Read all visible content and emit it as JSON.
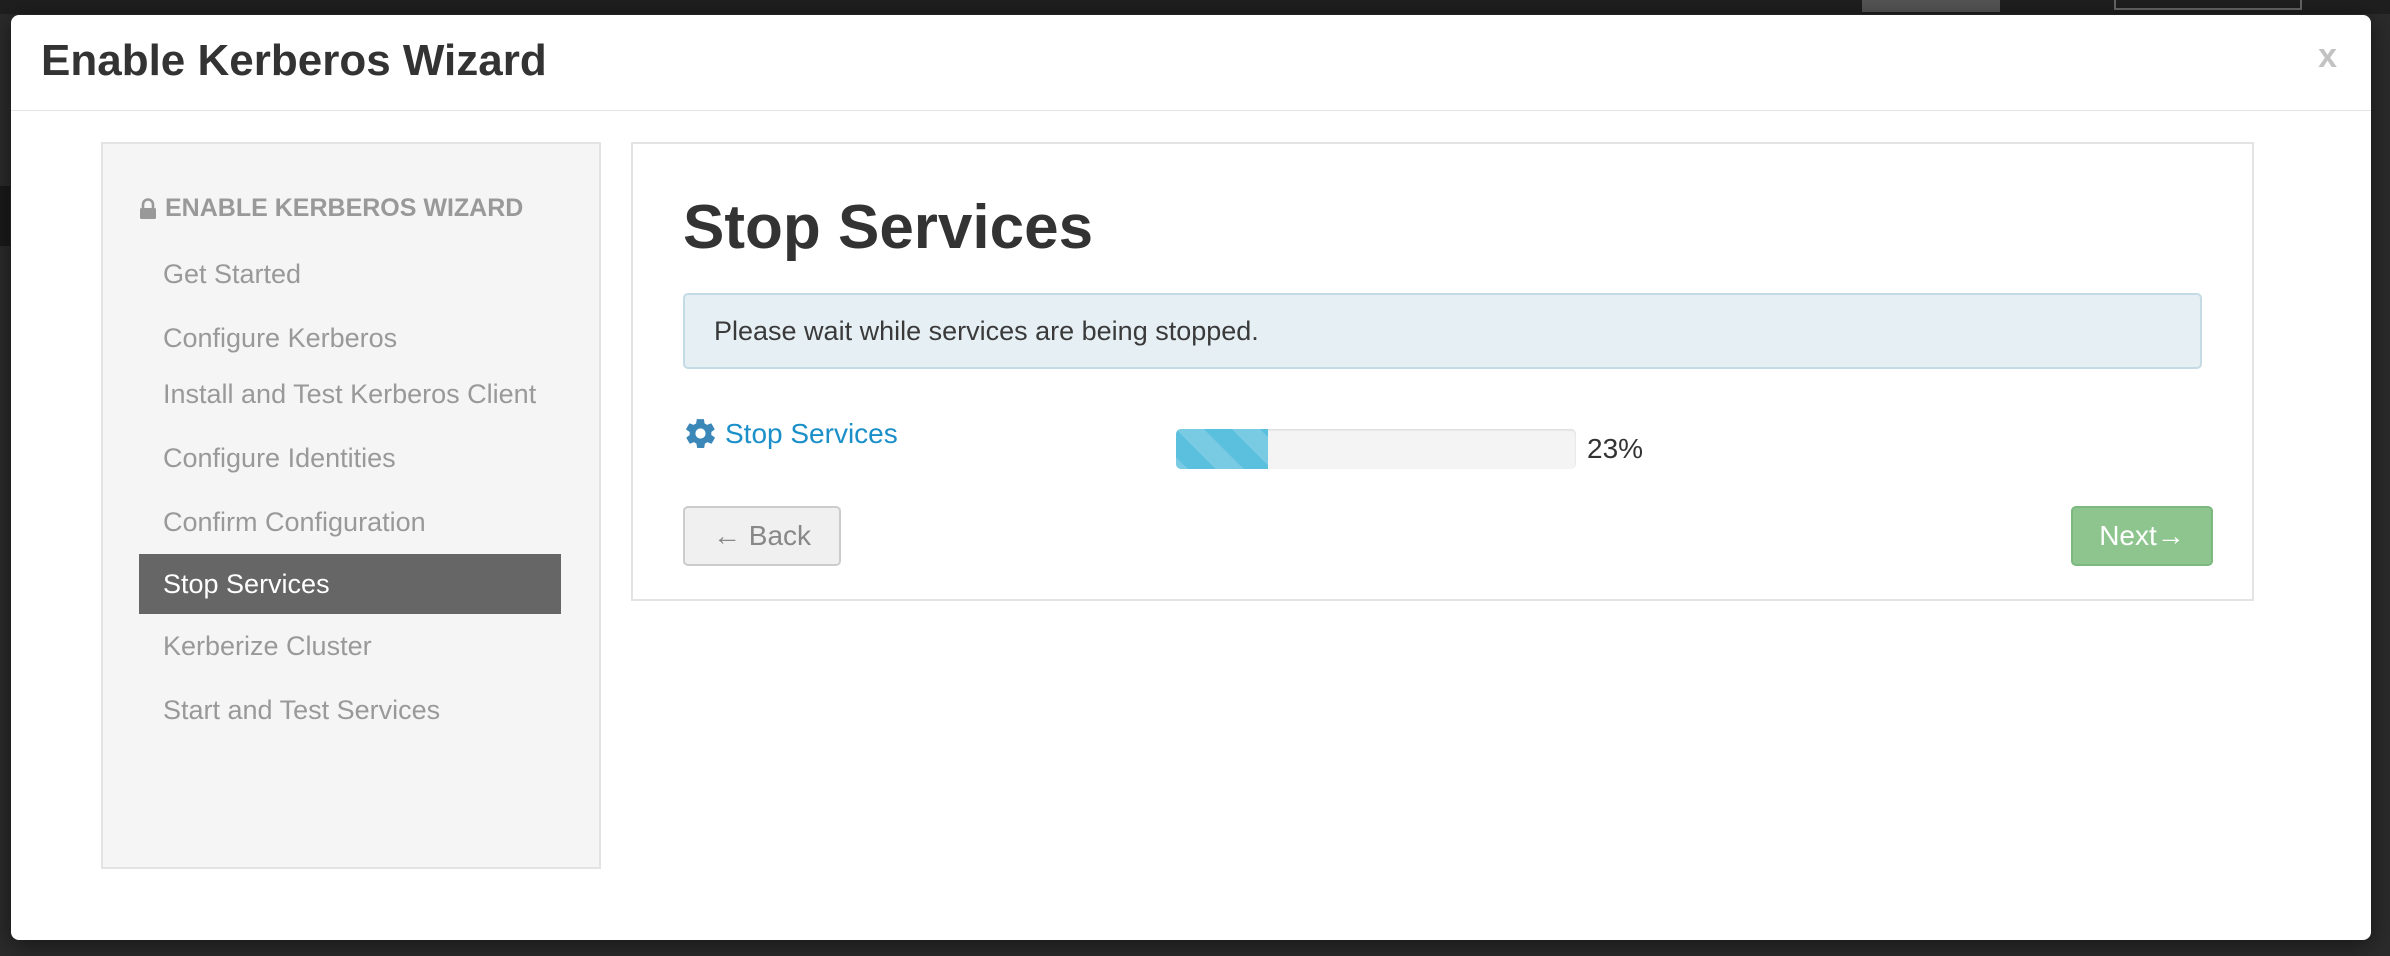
{
  "modal": {
    "title": "Enable Kerberos Wizard",
    "close_label": "x"
  },
  "sidebar": {
    "header": "ENABLE KERBEROS WIZARD",
    "items": [
      {
        "label": "Get Started",
        "active": false
      },
      {
        "label": "Configure Kerberos",
        "active": false
      },
      {
        "label": "Install and Test Kerberos Client",
        "active": false
      },
      {
        "label": "Configure Identities",
        "active": false
      },
      {
        "label": "Confirm Configuration",
        "active": false
      },
      {
        "label": "Stop Services",
        "active": true
      },
      {
        "label": "Kerberize Cluster",
        "active": false
      },
      {
        "label": "Start and Test Services",
        "active": false
      }
    ]
  },
  "content": {
    "title": "Stop Services",
    "alert_text": "Please wait while services are being stopped.",
    "task": {
      "icon": "gear-icon",
      "label": "Stop Services",
      "progress_percent": 23,
      "progress_label": "23%"
    },
    "back_button": "← Back",
    "next_button": "Next→"
  },
  "colors": {
    "accent_link": "#1a8fc8",
    "progress_fill": "#5bc0de",
    "active_step_bg": "#666666",
    "next_button_bg": "#8ec58f",
    "info_alert_bg": "#e6f0f4"
  }
}
